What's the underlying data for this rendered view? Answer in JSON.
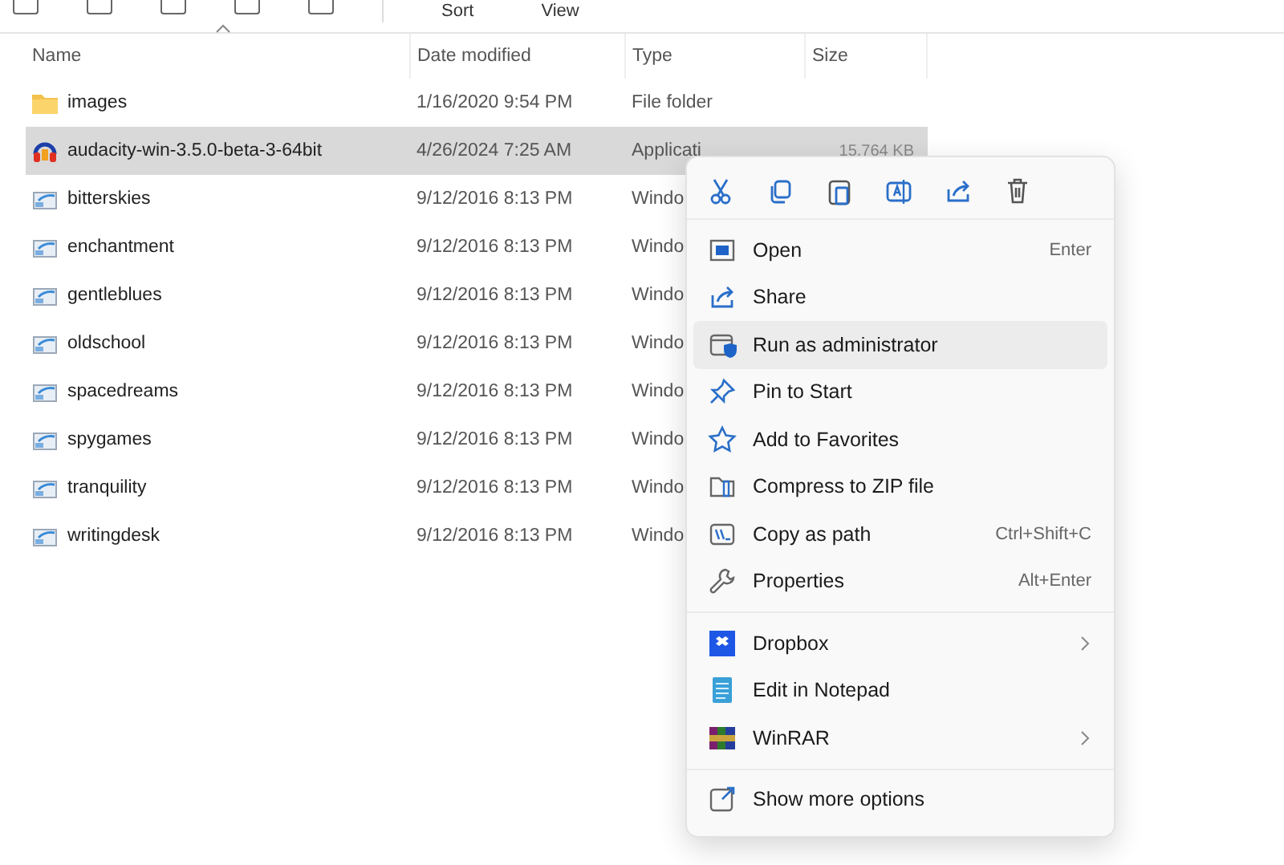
{
  "toolbar": {
    "buttons": [
      {
        "label": "Sort"
      },
      {
        "label": "View"
      }
    ]
  },
  "table": {
    "columns": [
      "Name",
      "Date modified",
      "Type",
      "Size"
    ],
    "rows": [
      {
        "kind": "folder",
        "name": "images",
        "date": "1/16/2020 9:54 PM",
        "type": "File folder",
        "selected": false
      },
      {
        "kind": "app",
        "name": "audacity-win-3.5.0-beta-3-64bit",
        "date": "4/26/2024 7:25 AM",
        "type": "Applicati",
        "size": "15,764 KB",
        "selected": true
      },
      {
        "kind": "sound",
        "name": "bitterskies",
        "date": "9/12/2016 8:13 PM",
        "type": "Windo",
        "selected": false
      },
      {
        "kind": "sound",
        "name": "enchantment",
        "date": "9/12/2016 8:13 PM",
        "type": "Windo",
        "selected": false
      },
      {
        "kind": "sound",
        "name": "gentleblues",
        "date": "9/12/2016 8:13 PM",
        "type": "Windo",
        "selected": false
      },
      {
        "kind": "sound",
        "name": "oldschool",
        "date": "9/12/2016 8:13 PM",
        "type": "Windo",
        "selected": false
      },
      {
        "kind": "sound",
        "name": "spacedreams",
        "date": "9/12/2016 8:13 PM",
        "type": "Windo",
        "selected": false
      },
      {
        "kind": "sound",
        "name": "spygames",
        "date": "9/12/2016 8:13 PM",
        "type": "Windo",
        "selected": false
      },
      {
        "kind": "sound",
        "name": "tranquility",
        "date": "9/12/2016 8:13 PM",
        "type": "Windo",
        "selected": false
      },
      {
        "kind": "sound",
        "name": "writingdesk",
        "date": "9/12/2016 8:13 PM",
        "type": "Windo",
        "selected": false
      }
    ]
  },
  "context_menu": {
    "sections": [
      [
        {
          "label": "Open",
          "shortcut": "Enter",
          "selected": false
        },
        {
          "label": "Share",
          "selected": false
        },
        {
          "label": "Run as administrator",
          "selected": true
        },
        {
          "label": "Pin to Start",
          "selected": false
        },
        {
          "label": "Add to Favorites",
          "selected": false
        },
        {
          "label": "Compress to ZIP file",
          "selected": false
        },
        {
          "label": "Copy as path",
          "shortcut": "Ctrl+Shift+C",
          "selected": false
        },
        {
          "label": "Properties",
          "shortcut": "Alt+Enter",
          "selected": false
        }
      ],
      [
        {
          "label": "Dropbox",
          "submenu": true,
          "selected": false
        },
        {
          "label": "Edit in Notepad",
          "selected": false
        },
        {
          "label": "WinRAR",
          "submenu": true,
          "selected": false
        }
      ],
      [
        {
          "label": "Show more options",
          "selected": false
        }
      ]
    ]
  }
}
